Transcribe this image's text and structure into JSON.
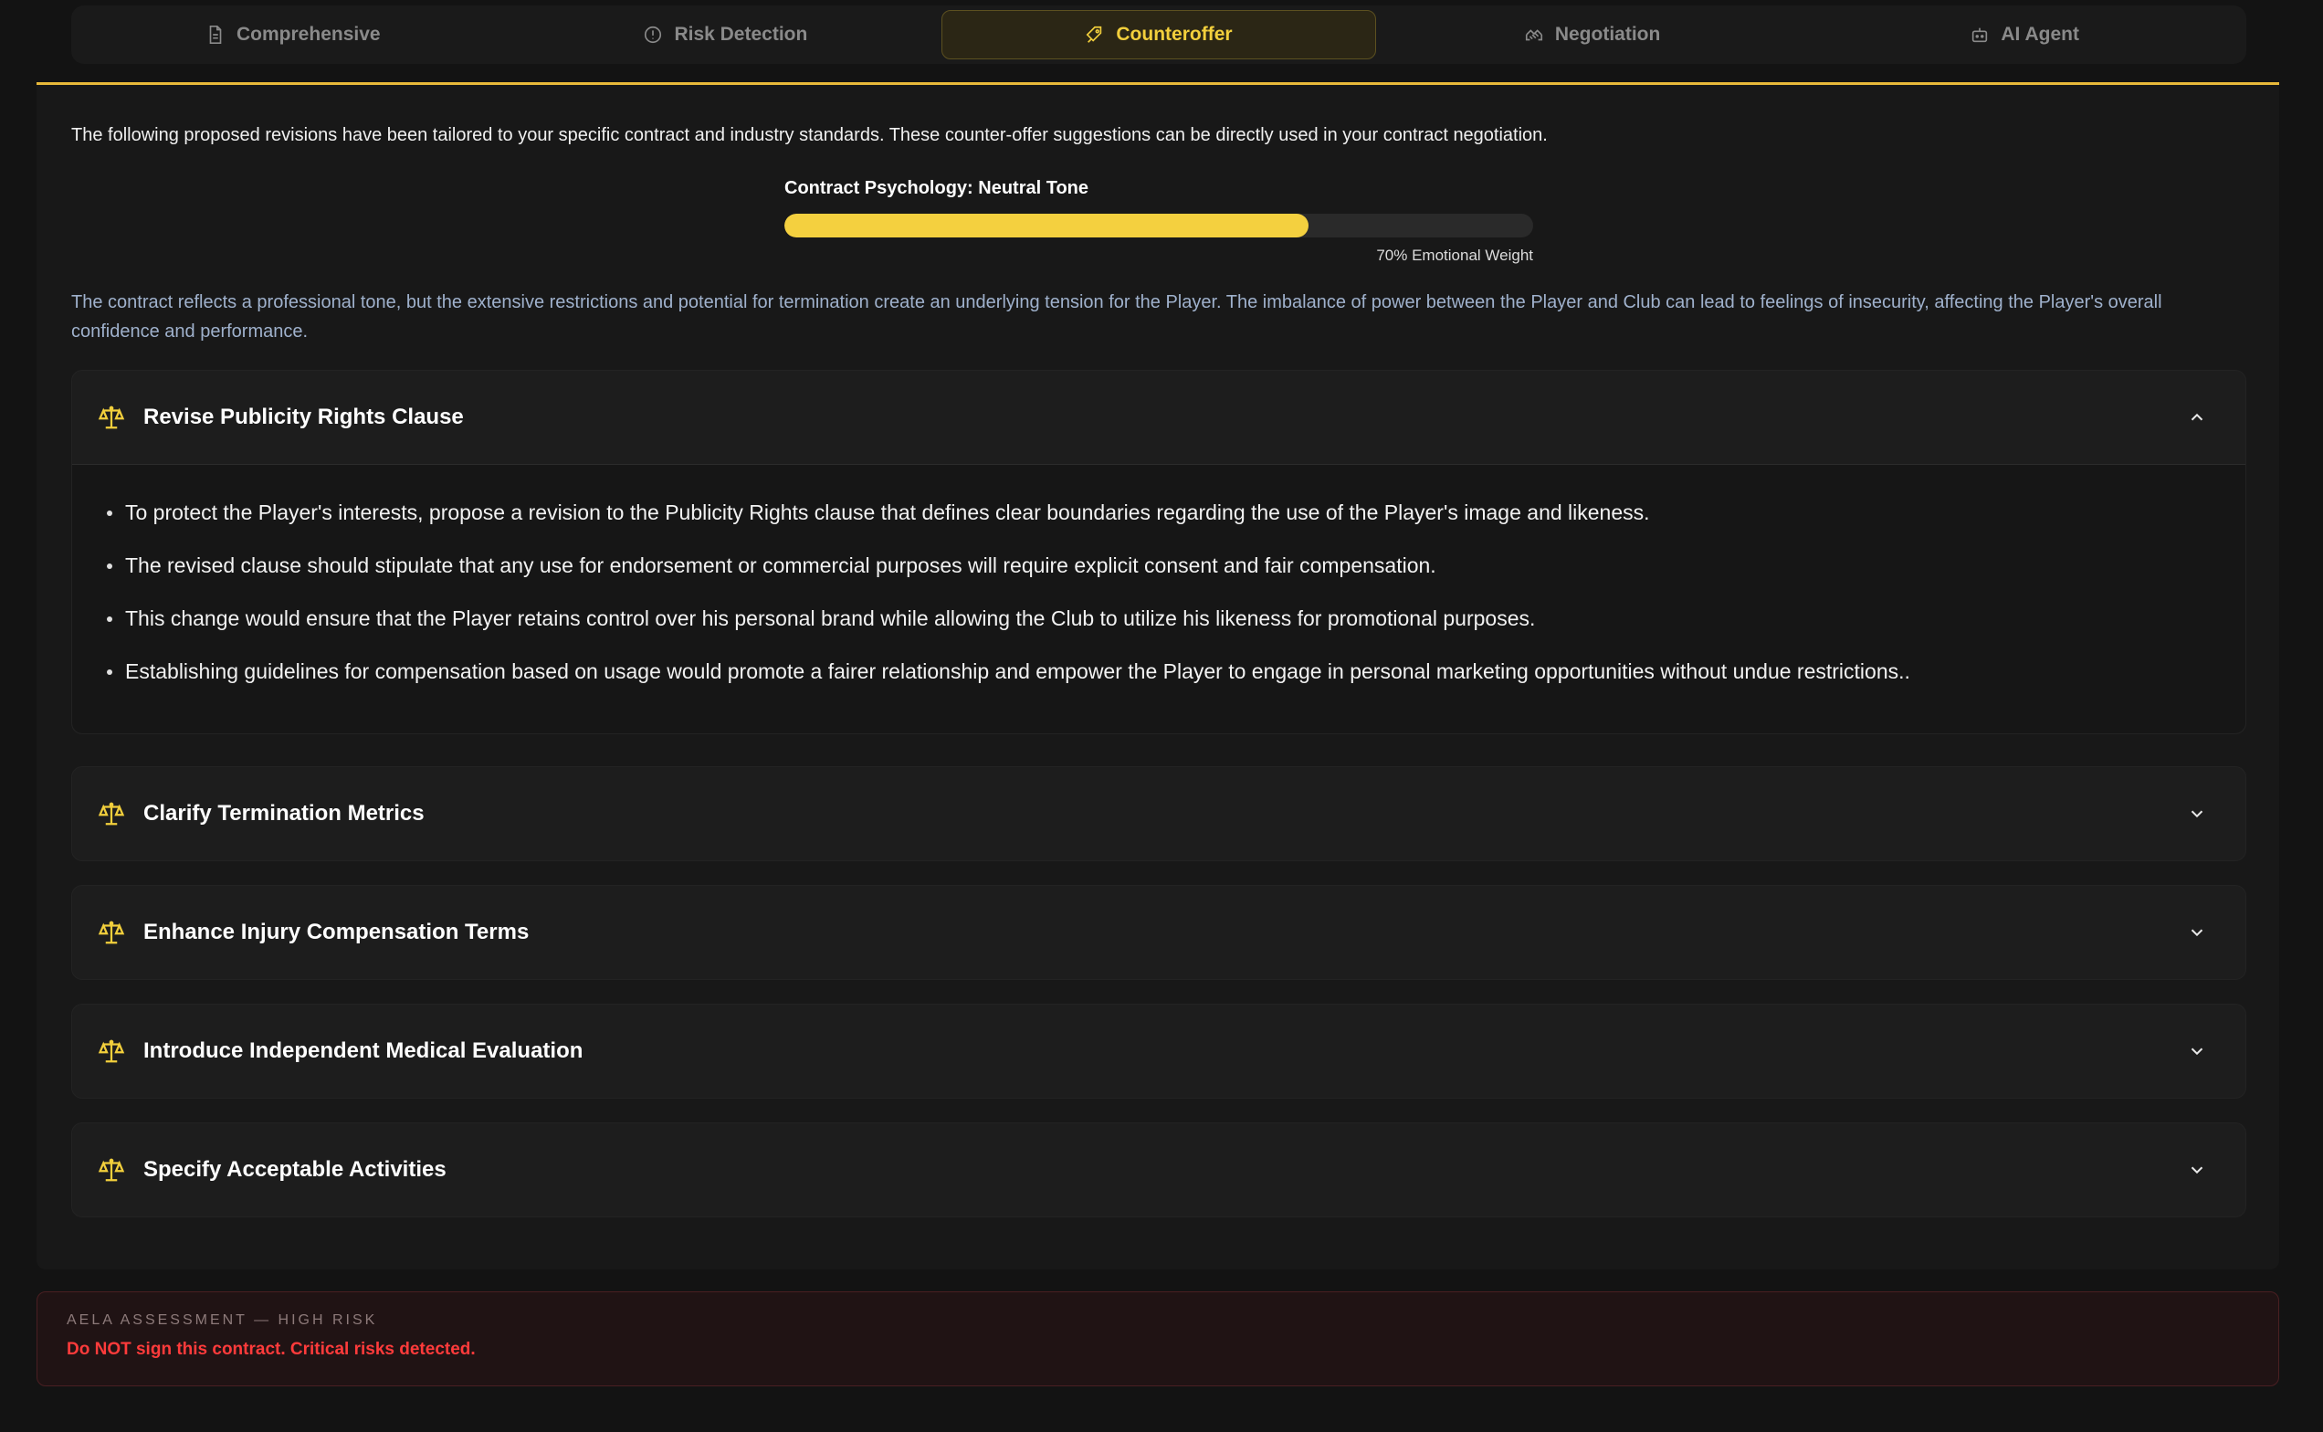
{
  "tabs": [
    {
      "label": "Comprehensive",
      "icon": "document-icon",
      "active": false
    },
    {
      "label": "Risk Detection",
      "icon": "alert-circle-icon",
      "active": false
    },
    {
      "label": "Counteroffer",
      "icon": "pen-tag-icon",
      "active": true
    },
    {
      "label": "Negotiation",
      "icon": "handshake-icon",
      "active": false
    },
    {
      "label": "AI Agent",
      "icon": "bot-icon",
      "active": false
    }
  ],
  "intro": "The following proposed revisions have been tailored to your specific contract and industry standards. These counter-offer suggestions can be directly used in your contract negotiation.",
  "psychology": {
    "title": "Contract Psychology: Neutral Tone",
    "percent": 70,
    "label": "70% Emotional Weight"
  },
  "summary": "The contract reflects a professional tone, but the extensive restrictions and potential for termination create an underlying tension for the Player. The imbalance of power between the Player and Club can lead to feelings of insecurity, affecting the Player's overall confidence and performance.",
  "sections": [
    {
      "title": "Revise Publicity Rights Clause",
      "expanded": true,
      "items": [
        "To protect the Player's interests, propose a revision to the Publicity Rights clause that defines clear boundaries regarding the use of the Player's image and likeness.",
        "The revised clause should stipulate that any use for endorsement or commercial purposes will require explicit consent and fair compensation.",
        "This change would ensure that the Player retains control over his personal brand while allowing the Club to utilize his likeness for promotional purposes.",
        "Establishing guidelines for compensation based on usage would promote a fairer relationship and empower the Player to engage in personal marketing opportunities without undue restrictions.."
      ]
    },
    {
      "title": "Clarify Termination Metrics",
      "expanded": false
    },
    {
      "title": "Enhance Injury Compensation Terms",
      "expanded": false
    },
    {
      "title": "Introduce Independent Medical Evaluation",
      "expanded": false
    },
    {
      "title": "Specify Acceptable Activities",
      "expanded": false
    }
  ],
  "assessment": {
    "label": "AELA ASSESSMENT — HIGH RISK",
    "text": "Do NOT sign this contract. Critical risks detected."
  },
  "colors": {
    "accent": "#f2cf3c",
    "danger": "#ff3b3b",
    "summary_text": "#9fb1cc"
  }
}
